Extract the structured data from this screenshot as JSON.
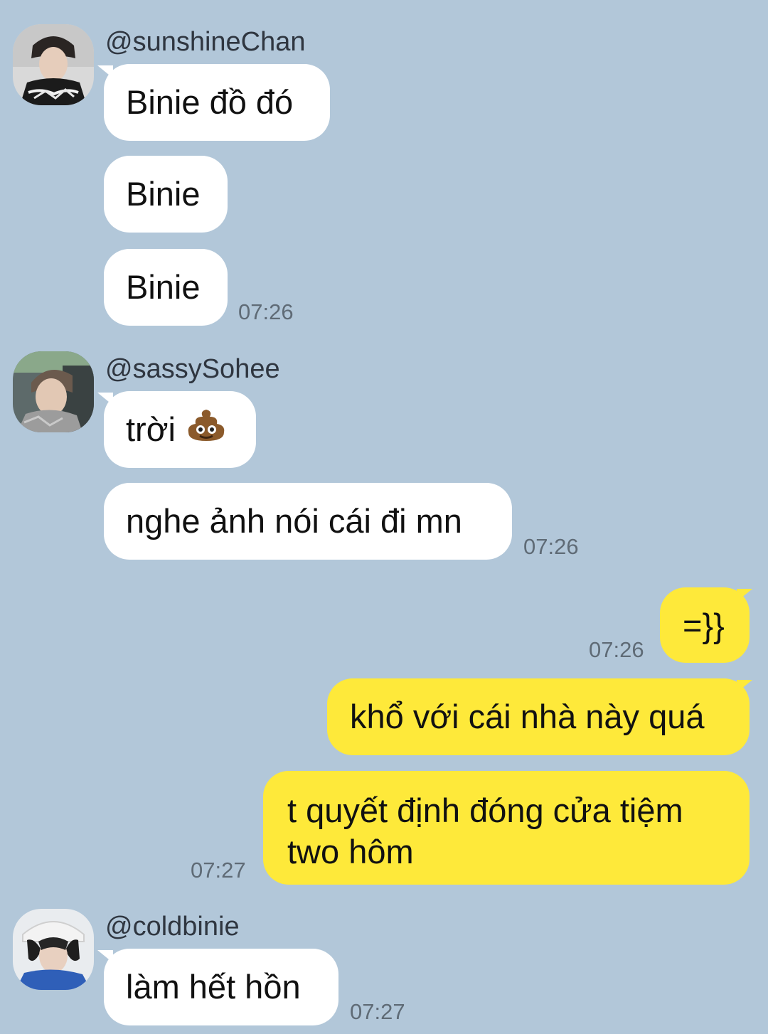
{
  "conversation": {
    "groups": [
      {
        "sender": "@sunshineChan",
        "messages": [
          "Binie đồ đó",
          "Binie",
          "Binie"
        ],
        "time": "07:26"
      },
      {
        "sender": "@sassySohee",
        "messages": [
          "trời",
          "nghe ảnh nói cái đi mn"
        ],
        "emoji": "poop-emoji",
        "time": "07:26"
      },
      {
        "sender": "me",
        "messages": [
          "=}}",
          "khổ với cái nhà này quá",
          "t quyết định đóng cửa tiệm two hôm"
        ],
        "times": [
          "07:26",
          "07:27"
        ]
      },
      {
        "sender": "@coldbinie",
        "messages": [
          "làm hết hồn"
        ],
        "time": "07:27"
      }
    ]
  },
  "colors": {
    "background": "#b2c7d9",
    "incoming_bubble": "#ffffff",
    "outgoing_bubble": "#fee93a",
    "time_text": "#5f6b76"
  }
}
